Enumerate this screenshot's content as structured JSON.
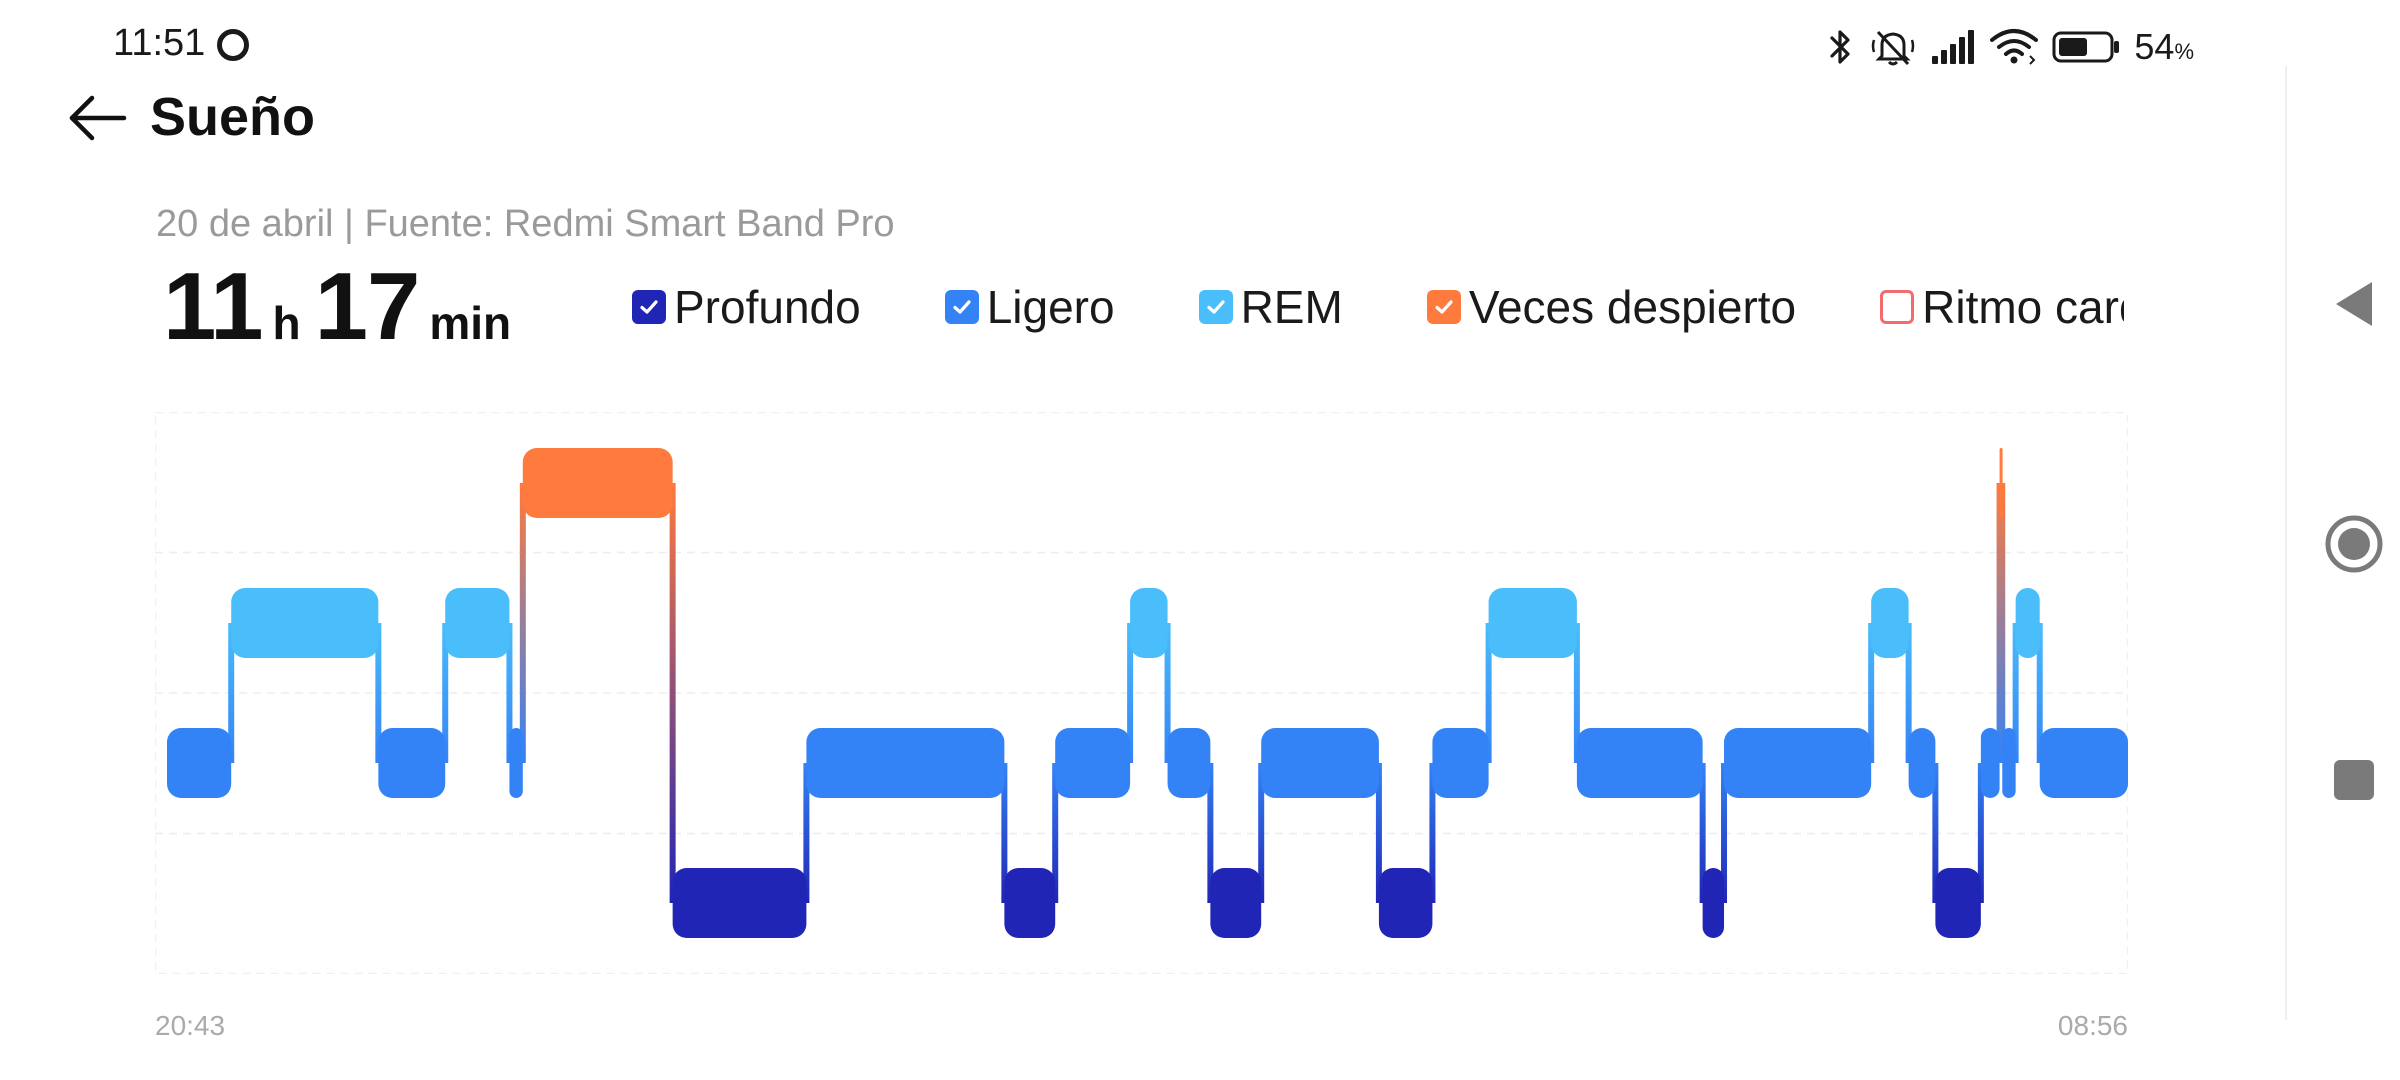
{
  "status_bar": {
    "time": "11:51",
    "battery_percent": "54",
    "battery_unit": "%",
    "icons": [
      "bluetooth-icon",
      "silent-icon",
      "signal-icon",
      "wifi-icon",
      "battery-icon"
    ]
  },
  "header": {
    "title": "Sueño",
    "back_icon": "arrow-left-icon"
  },
  "summary": {
    "date_source": "20 de abril | Fuente: Redmi Smart Band Pro",
    "hours": "11",
    "hours_unit": "h",
    "minutes": "17",
    "minutes_unit": "min"
  },
  "legend": [
    {
      "label": "Profundo",
      "checked": true,
      "color": "#2125B5"
    },
    {
      "label": "Ligero",
      "checked": true,
      "color": "#3483F6"
    },
    {
      "label": "REM",
      "checked": true,
      "color": "#4ABDFB"
    },
    {
      "label": "Veces despierto",
      "checked": true,
      "color": "#FE7A3D"
    },
    {
      "label": "Ritmo cardíaco",
      "checked": false,
      "color": "#F36B6E"
    }
  ],
  "chart_data": {
    "type": "sleep-stage hypnogram",
    "x_start_label": "20:43",
    "x_end_label": "08:56",
    "levels": [
      "Despierto",
      "REM",
      "Ligero",
      "Profundo"
    ],
    "colors": {
      "Despierto": "#FE7A3D",
      "REM": "#4ABDFB",
      "Ligero": "#3483F6",
      "Profundo": "#2125B5"
    },
    "segments": [
      {
        "stage": "Ligero",
        "start_min": 0,
        "end_min": 24
      },
      {
        "stage": "REM",
        "start_min": 24,
        "end_min": 79
      },
      {
        "stage": "Ligero",
        "start_min": 79,
        "end_min": 104
      },
      {
        "stage": "REM",
        "start_min": 104,
        "end_min": 128
      },
      {
        "stage": "Ligero",
        "start_min": 128,
        "end_min": 133
      },
      {
        "stage": "Despierto",
        "start_min": 133,
        "end_min": 189
      },
      {
        "stage": "Profundo",
        "start_min": 189,
        "end_min": 239
      },
      {
        "stage": "Ligero",
        "start_min": 239,
        "end_min": 313
      },
      {
        "stage": "Profundo",
        "start_min": 313,
        "end_min": 332
      },
      {
        "stage": "Ligero",
        "start_min": 332,
        "end_min": 360
      },
      {
        "stage": "REM",
        "start_min": 360,
        "end_min": 374
      },
      {
        "stage": "Ligero",
        "start_min": 374,
        "end_min": 390
      },
      {
        "stage": "Profundo",
        "start_min": 390,
        "end_min": 409
      },
      {
        "stage": "Ligero",
        "start_min": 409,
        "end_min": 453
      },
      {
        "stage": "Profundo",
        "start_min": 453,
        "end_min": 473
      },
      {
        "stage": "Ligero",
        "start_min": 473,
        "end_min": 494
      },
      {
        "stage": "REM",
        "start_min": 494,
        "end_min": 527
      },
      {
        "stage": "Ligero",
        "start_min": 527,
        "end_min": 574
      },
      {
        "stage": "Profundo",
        "start_min": 574,
        "end_min": 582
      },
      {
        "stage": "Ligero",
        "start_min": 582,
        "end_min": 637
      },
      {
        "stage": "REM",
        "start_min": 637,
        "end_min": 651
      },
      {
        "stage": "Ligero",
        "start_min": 651,
        "end_min": 661
      },
      {
        "stage": "Profundo",
        "start_min": 661,
        "end_min": 678
      },
      {
        "stage": "Ligero",
        "start_min": 678,
        "end_min": 685
      },
      {
        "stage": "Despierto",
        "start_min": 685,
        "end_min": 686
      },
      {
        "stage": "Ligero",
        "start_min": 686,
        "end_min": 691
      },
      {
        "stage": "REM",
        "start_min": 691,
        "end_min": 700
      },
      {
        "stage": "Ligero",
        "start_min": 700,
        "end_min": 733
      }
    ],
    "grid": true,
    "legend_position": "top"
  }
}
